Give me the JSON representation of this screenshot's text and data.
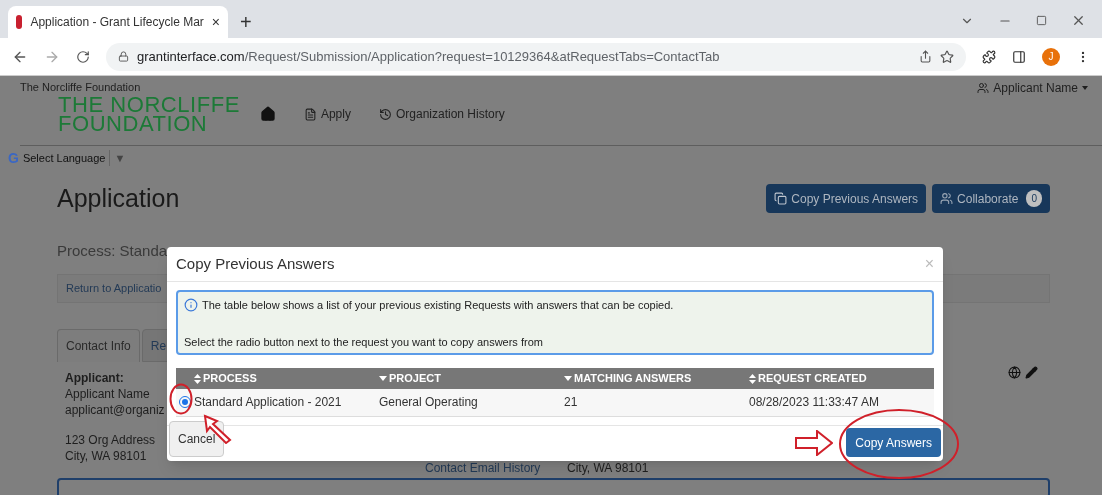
{
  "browser": {
    "tab_title": "Application - Grant Lifecycle Mar",
    "tab_close": "×",
    "new_tab": "+",
    "url_host": "grantinterface.com",
    "url_path": "/Request/Submission/Application?request=10129364&atRequestTabs=ContactTab",
    "profile_initial": "J"
  },
  "page": {
    "org_name": "The Norcliffe Foundation",
    "logo_lines": [
      "THE NORCLIFFE",
      "FOUNDATION"
    ],
    "nav": [
      {
        "kind": "file",
        "label": "Apply"
      },
      {
        "kind": "history",
        "label": "Organization History"
      }
    ],
    "user": "Applicant Name",
    "language_logo": "G",
    "language": "Select Language",
    "language_caret": "▼",
    "title": "Application",
    "actions": [
      {
        "kind": "copy",
        "label": "Copy Previous Answers"
      },
      {
        "kind": "people",
        "label": "Collaborate",
        "badge": "0"
      }
    ],
    "process": "Process: Standa",
    "return_link": "Return to Applicatio",
    "tabs": [
      {
        "label": "Contact Info",
        "selected": true
      },
      {
        "label": "Re",
        "selected": false
      }
    ],
    "applicant": {
      "heading": "Applicant:",
      "lines": [
        "Applicant Name",
        "applicant@organiz"
      ],
      "address": [
        "123 Org Address",
        "City, WA 98101"
      ]
    },
    "contact_email_history": "Contact Email History",
    "second_city": "City, WA 98101"
  },
  "modal": {
    "title": "Copy Previous Answers",
    "close": "×",
    "info": "The table below shows a list of your previous existing Requests with answers that can be copied.",
    "instruction": "Select the radio button next to the request you want to copy answers from",
    "columns": [
      {
        "label": "PROCESS",
        "kind": "sortable"
      },
      {
        "label": "PROJECT",
        "kind": "sorted"
      },
      {
        "label": "MATCHING ANSWERS",
        "kind": "sorted"
      },
      {
        "label": "REQUEST CREATED",
        "kind": "sortable"
      }
    ],
    "rows": [
      {
        "selected": true,
        "cells": [
          "Standard Application - 2021",
          "General Operating",
          "21",
          "08/28/2023 11:33:47 AM"
        ]
      }
    ],
    "cancel": "Cancel",
    "confirm": "Copy Answers"
  }
}
